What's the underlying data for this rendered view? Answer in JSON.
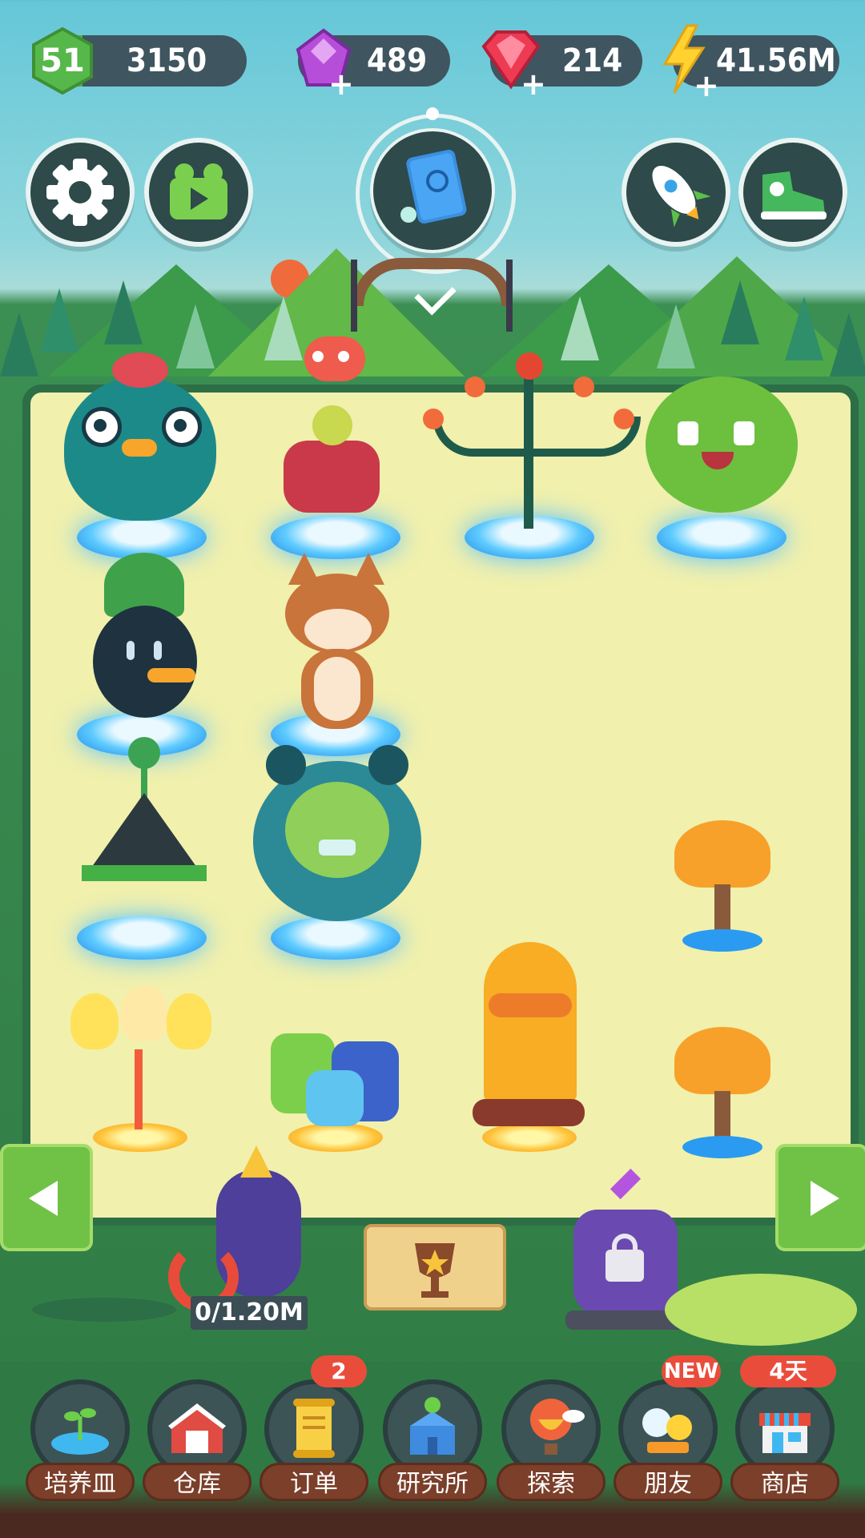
{
  "hud": {
    "level": "51",
    "xp": "3150",
    "xp_progress": 0.2,
    "purple_gems": "489",
    "red_gems": "214",
    "energy": "41.56M"
  },
  "top_buttons": {
    "settings_icon": "gear-icon",
    "video_icon": "video-icon",
    "book_icon": "book-icon",
    "rocket_icon": "rocket-icon",
    "sneaker_icon": "sneaker-icon"
  },
  "scene": {
    "collect_progress": "0/1.20M"
  },
  "nav": {
    "items": [
      {
        "label": "培养皿",
        "icon": "petri-dish-icon"
      },
      {
        "label": "仓库",
        "icon": "barn-icon"
      },
      {
        "label": "订单",
        "icon": "scroll-icon",
        "badge": "2"
      },
      {
        "label": "研究所",
        "icon": "lab-icon"
      },
      {
        "label": "探索",
        "icon": "balloon-icon"
      },
      {
        "label": "朋友",
        "icon": "friends-icon",
        "badge": "NEW"
      },
      {
        "label": "商店",
        "icon": "shop-icon",
        "badge": "4天"
      }
    ]
  },
  "colors": {
    "field": "#f1f0ad",
    "nav_label": "#7b3f2a",
    "badge": "#ea4c3c",
    "level_hex": "#56b84a"
  }
}
